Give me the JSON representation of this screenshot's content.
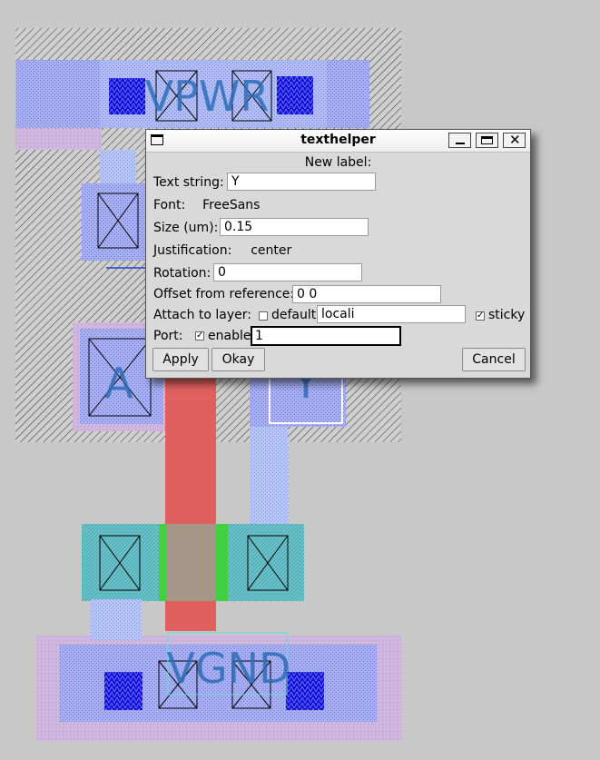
{
  "layout_labels": {
    "vpwr": "VPWR",
    "vgnd": "VGND",
    "a": "A",
    "y": "Y"
  },
  "dialog": {
    "title": "texthelper",
    "heading": "New label:",
    "text_string_label": "Text string:",
    "text_string_value": "Y",
    "font_label": "Font:",
    "font_value": "FreeSans",
    "size_label": "Size (um):",
    "size_value": "0.15",
    "justification_label": "Justification:",
    "justification_value": "center",
    "rotation_label": "Rotation:",
    "rotation_value": "0",
    "offset_label": "Offset from reference:",
    "offset_value": "0 0",
    "attach_label": "Attach to layer:",
    "default_label": "default",
    "default_checked": false,
    "layer_value": "locali",
    "sticky_label": "sticky",
    "sticky_checked": true,
    "port_label": "Port:",
    "enable_label": "enable",
    "enable_checked": true,
    "port_value": "1",
    "apply_label": "Apply",
    "okay_label": "Okay",
    "cancel_label": "Cancel"
  },
  "window_controls": [
    "minimize-icon",
    "maximize-icon",
    "close-icon"
  ],
  "colors": {
    "background": "#c8c8c8",
    "nwell_hatch": "#303030",
    "metal1": "#8f9cf0",
    "local_interconnect": "#a6a6f5",
    "poly": "#e06060",
    "diffusion": "#60c0b8",
    "ndiff_green": "#40d040",
    "pwell": "#c8a8d8",
    "contact": "#0000cc",
    "label_text": "#2e6db8"
  }
}
